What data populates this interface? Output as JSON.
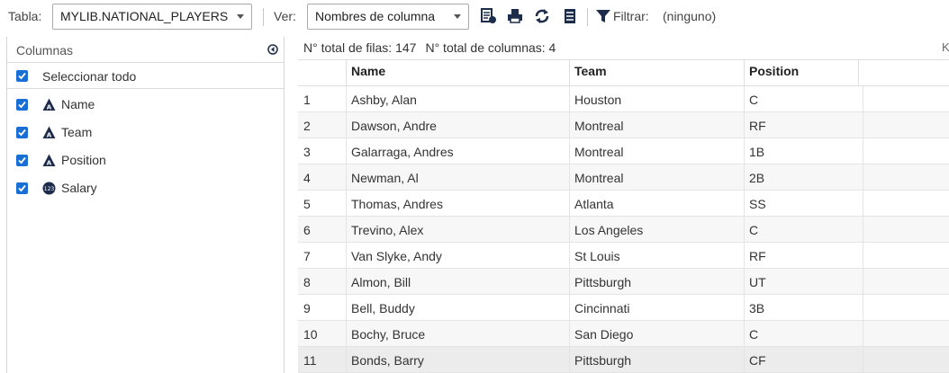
{
  "toolbar": {
    "table_label": "Tabla:",
    "table_value": "MYLIB.NATIONAL_PLAYERS",
    "view_label": "Ver:",
    "view_value": "Nombres de columna",
    "filter_label": "Filtrar:",
    "filter_value": "(ninguno)",
    "icons": [
      "table-properties-icon",
      "print-icon",
      "refresh-icon",
      "column-list-icon",
      "filter-icon"
    ]
  },
  "columns_panel": {
    "title": "Columnas",
    "select_all": "Seleccionar todo",
    "items": [
      {
        "label": "Name",
        "type": "character",
        "checked": true
      },
      {
        "label": "Team",
        "type": "character",
        "checked": true
      },
      {
        "label": "Position",
        "type": "character",
        "checked": true
      },
      {
        "label": "Salary",
        "type": "numeric",
        "checked": true
      }
    ],
    "numeric_badge": "123"
  },
  "grid": {
    "total_rows": "N° total de filas: 147",
    "total_columns": "N° total de columnas: 4",
    "right_glyph": "K",
    "headers": [
      "Name",
      "Team",
      "Position"
    ],
    "rows": [
      [
        "1",
        "Ashby, Alan",
        "Houston",
        "C"
      ],
      [
        "2",
        "Dawson, Andre",
        "Montreal",
        "RF"
      ],
      [
        "3",
        "Galarraga, Andres",
        "Montreal",
        "1B"
      ],
      [
        "4",
        "Newman, Al",
        "Montreal",
        "2B"
      ],
      [
        "5",
        "Thomas, Andres",
        "Atlanta",
        "SS"
      ],
      [
        "6",
        "Trevino, Alex",
        "Los Angeles",
        "C"
      ],
      [
        "7",
        "Van Slyke, Andy",
        "St Louis",
        "RF"
      ],
      [
        "8",
        "Almon, Bill",
        "Pittsburgh",
        "UT"
      ],
      [
        "9",
        "Bell, Buddy",
        "Cincinnati",
        "3B"
      ],
      [
        "10",
        "Bochy, Bruce",
        "San Diego",
        "C"
      ],
      [
        "11",
        "Bonds, Barry",
        "Pittsburgh",
        "CF"
      ]
    ],
    "selected_row": 11
  },
  "colors": {
    "accent": "#1a6fd4",
    "icon_dark": "#1c2c4a"
  }
}
